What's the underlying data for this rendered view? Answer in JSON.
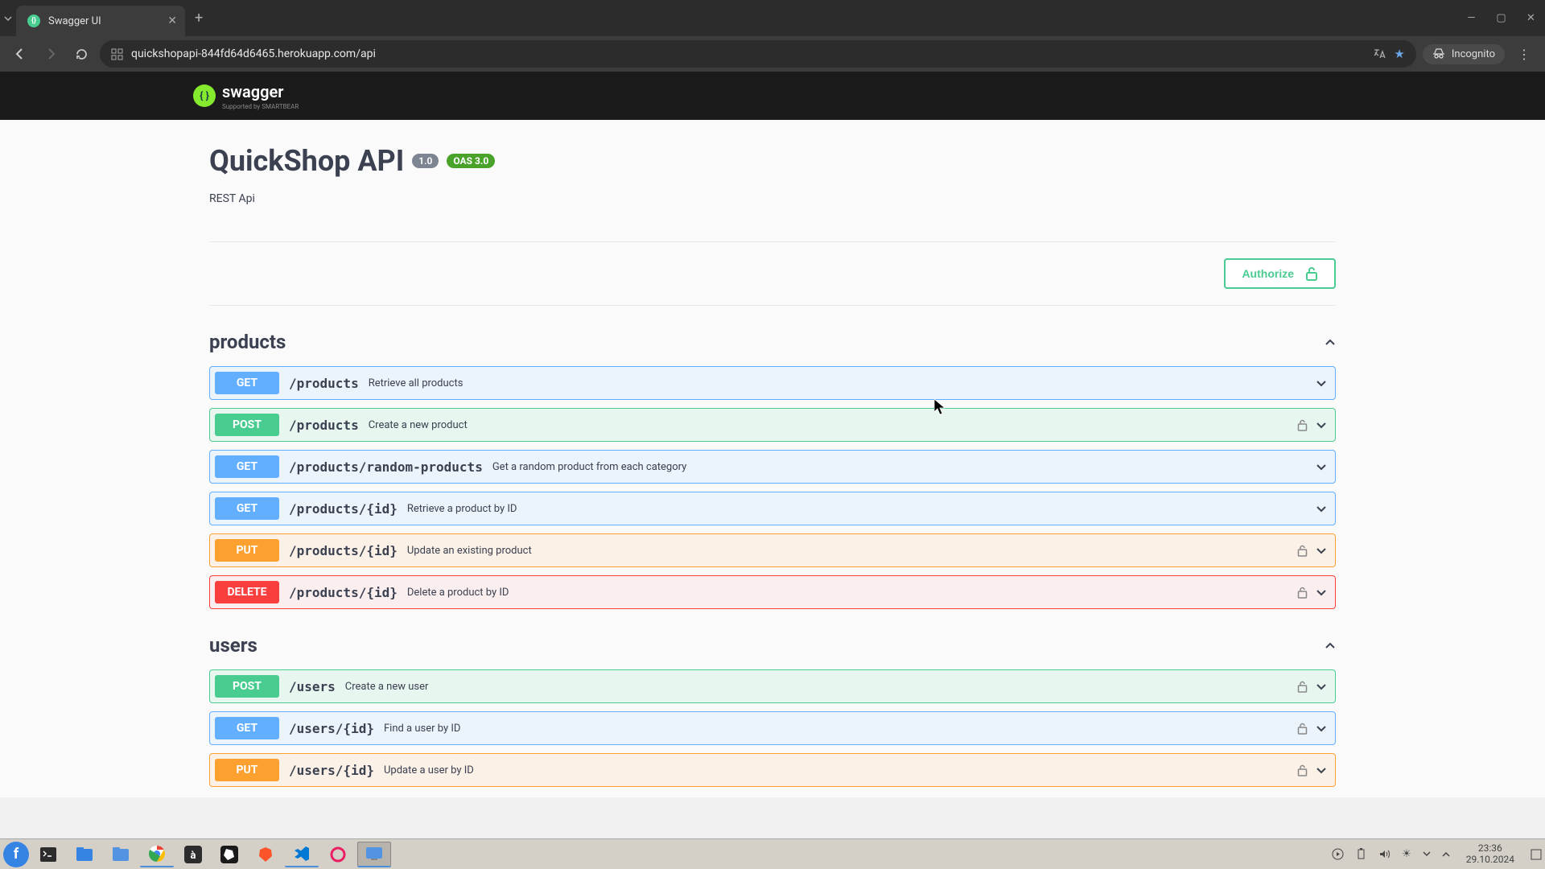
{
  "browser": {
    "tab_title": "Swagger UI",
    "url": "quickshopapi-844fd64d6465.herokuapp.com/api",
    "incognito_label": "Incognito"
  },
  "logo": {
    "text": "swagger",
    "sub": "Supported by SMARTBEAR"
  },
  "api": {
    "title": "QuickShop API",
    "version": "1.0",
    "oas": "OAS 3.0",
    "description": "REST Api",
    "authorize": "Authorize"
  },
  "tags": [
    {
      "name": "products",
      "ops": [
        {
          "method": "GET",
          "path": "/products",
          "summary": "Retrieve all products",
          "locked": false
        },
        {
          "method": "POST",
          "path": "/products",
          "summary": "Create a new product",
          "locked": true
        },
        {
          "method": "GET",
          "path": "/products/random-products",
          "summary": "Get a random product from each category",
          "locked": false
        },
        {
          "method": "GET",
          "path": "/products/{id}",
          "summary": "Retrieve a product by ID",
          "locked": false
        },
        {
          "method": "PUT",
          "path": "/products/{id}",
          "summary": "Update an existing product",
          "locked": true
        },
        {
          "method": "DELETE",
          "path": "/products/{id}",
          "summary": "Delete a product by ID",
          "locked": true
        }
      ]
    },
    {
      "name": "users",
      "ops": [
        {
          "method": "POST",
          "path": "/users",
          "summary": "Create a new user",
          "locked": true
        },
        {
          "method": "GET",
          "path": "/users/{id}",
          "summary": "Find a user by ID",
          "locked": true
        },
        {
          "method": "PUT",
          "path": "/users/{id}",
          "summary": "Update a user by ID",
          "locked": true
        }
      ]
    }
  ],
  "system": {
    "time": "23:36",
    "date": "29.10.2024"
  }
}
